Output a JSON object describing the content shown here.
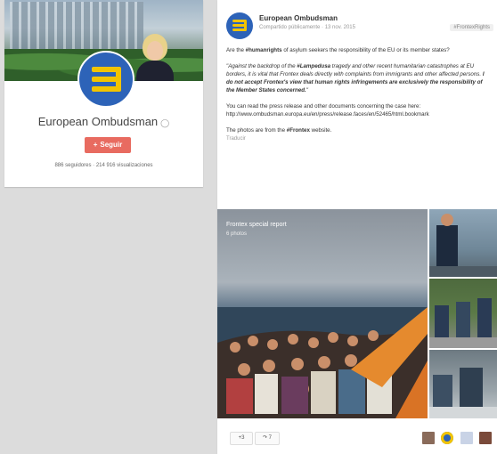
{
  "profile": {
    "name": "European Ombudsman",
    "follow_label": "Seguir",
    "stats": "886 seguidores · 214 916 visualizaciones"
  },
  "post": {
    "author": "European Ombudsman",
    "meta": "Compartido públicamente  ·  13 nov. 2015",
    "tag": "#FrontexRights",
    "body": {
      "p1_a": "Are the ",
      "p1_hashtag": "#humanrights",
      "p1_b": " of asylum seekers the responsibility of the EU or its member states?",
      "p2_a": "\"Against the backdrop of the ",
      "p2_hashtag": "#Lampedusa",
      "p2_b": " tragedy and other recent humanitarian catastrophes at EU borders, it is vital that Frontex deals directly with complaints from immigrants and other affected persons. ",
      "p2_bold": "I do not accept Frontex's view that human rights infringements are exclusively the responsibility of the Member States concerned.",
      "p2_c": "\"",
      "p3": "You can read the press release and other documents concerning the case here: http://www.ombudsman.europa.eu/en/press/release.faces/en/52465/html.bookmark",
      "p4_a": "The photos are from the ",
      "p4_hashtag": "#Frontex",
      "p4_b": " website.",
      "translate": "Traducir"
    },
    "album": {
      "title": "Frontex special report",
      "count": "6 photos"
    },
    "actions": {
      "plus_one": "+3",
      "share": "↷ 7"
    }
  },
  "colors": {
    "brand_blue": "#2d63b8",
    "brand_yellow": "#f2c400",
    "follow_red": "#e86b60"
  }
}
